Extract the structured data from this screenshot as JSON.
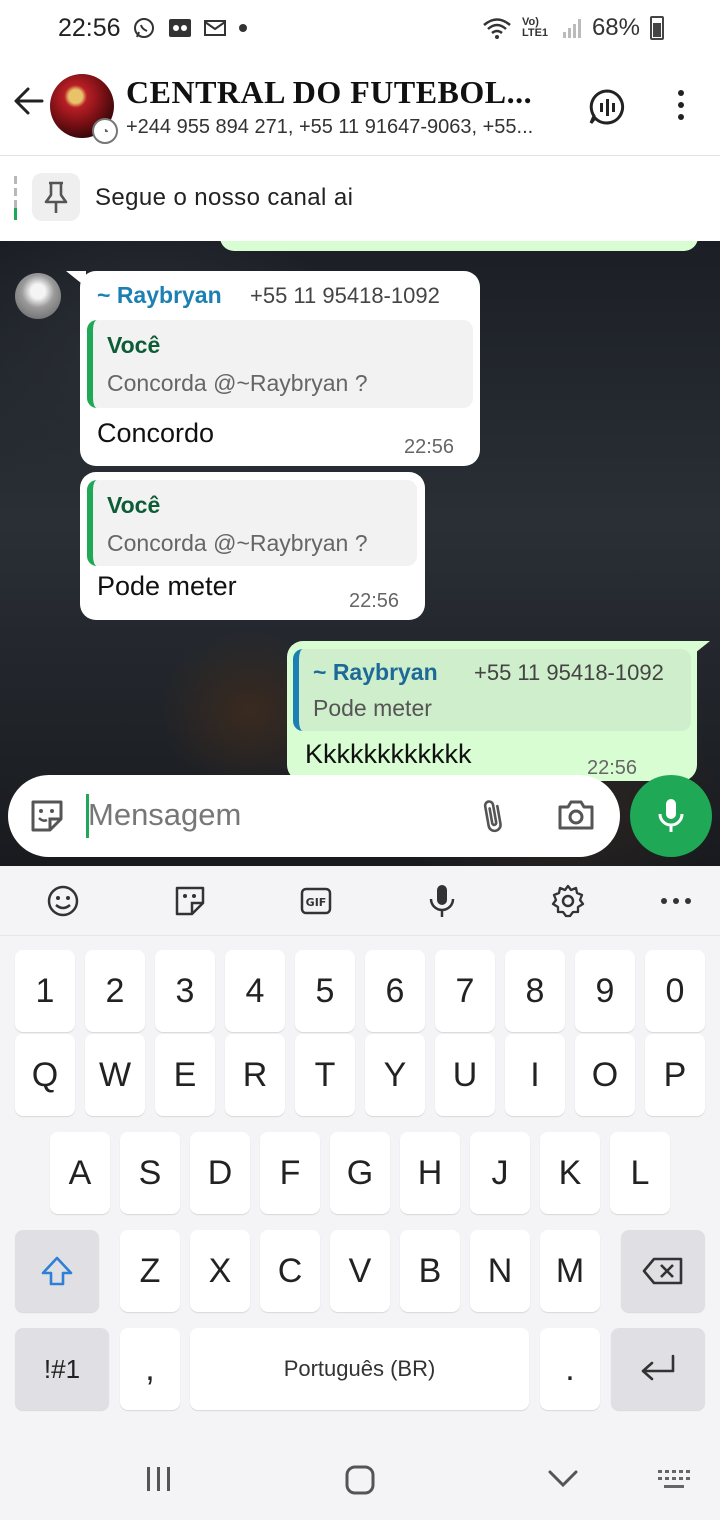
{
  "status_bar": {
    "time": "22:56",
    "network": "Vo) LTE1",
    "battery": "68%"
  },
  "header": {
    "title": "CENTRAL DO FUTEBOL...",
    "subtitle": "+244 955 894 271, +55 11 91647-9063, +55..."
  },
  "pinned": {
    "text": "Segue o nosso canal ai"
  },
  "messages": [
    {
      "direction": "in",
      "sender": "~ Raybryan",
      "sender_phone": "+55 11 95418-1092",
      "quote_author": "Você",
      "quote_text": "Concorda @~Raybryan ?",
      "text": "Concordo",
      "time": "22:56"
    },
    {
      "direction": "in",
      "quote_author": "Você",
      "quote_text": "Concorda @~Raybryan ?",
      "text": "Pode meter",
      "time": "22:56"
    },
    {
      "direction": "out",
      "quote_author": "~ Raybryan",
      "quote_phone": "+55 11 95418-1092",
      "quote_text": "Pode meter",
      "text": "Kkkkkkkkkkkk",
      "time": "22:56"
    }
  ],
  "composer": {
    "placeholder": "Mensagem"
  },
  "keyboard": {
    "row_numbers": [
      "1",
      "2",
      "3",
      "4",
      "5",
      "6",
      "7",
      "8",
      "9",
      "0"
    ],
    "row1": [
      "Q",
      "W",
      "E",
      "R",
      "T",
      "Y",
      "U",
      "I",
      "O",
      "P"
    ],
    "row2": [
      "A",
      "S",
      "D",
      "F",
      "G",
      "H",
      "J",
      "K",
      "L"
    ],
    "row3": [
      "Z",
      "X",
      "C",
      "V",
      "B",
      "N",
      "M"
    ],
    "symbols_label": "!#1",
    "comma": ",",
    "space_label": "Português (BR)",
    "period": "."
  },
  "colors": {
    "accent_green": "#1fa855",
    "outgoing_bubble": "#d9fdd3",
    "sender_blue": "#1d80b3"
  }
}
